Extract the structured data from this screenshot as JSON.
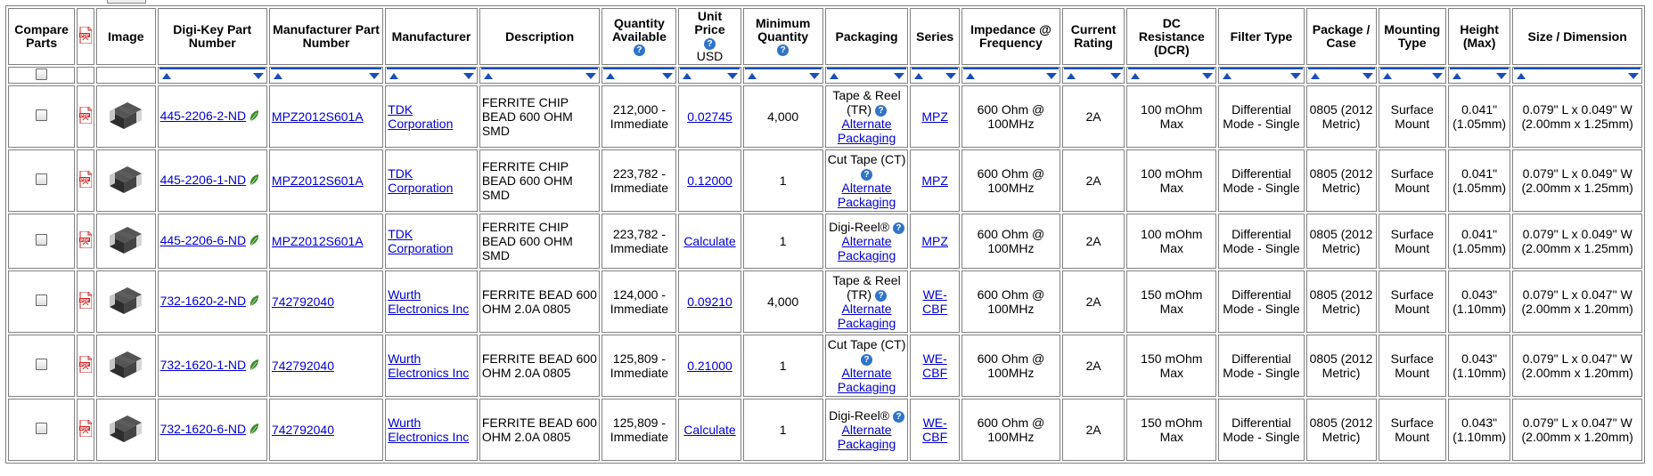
{
  "headers": {
    "compare": "Compare Parts",
    "image": "Image",
    "dk_part": "Digi-Key Part Number",
    "mfr_part": "Manufacturer Part Number",
    "manufacturer": "Manufacturer",
    "description": "Description",
    "qty_available": "Quantity Available",
    "unit_price": "Unit Price",
    "unit_price_currency": "USD",
    "min_qty": "Minimum Quantity",
    "packaging": "Packaging",
    "series": "Series",
    "impedance": "Impedance @ Frequency",
    "current": "Current Rating",
    "dcr": "DC Resistance (DCR)",
    "filter_type": "Filter Type",
    "package_case": "Package / Case",
    "mounting": "Mounting Type",
    "height": "Height (Max)",
    "size": "Size / Dimension"
  },
  "icons": {
    "help": "help-icon",
    "pdf": "pdf-datasheet-icon",
    "leaf": "rohs-leaf-icon",
    "sort_up": "sort-ascending-icon",
    "sort_down": "sort-descending-icon"
  },
  "colors": {
    "link": "#0000cc",
    "sort_accent": "#1b4fb7",
    "help_badge": "#2f74c8",
    "pdf_red": "#d42020",
    "leaf_green": "#3a8a2a"
  },
  "rows": [
    {
      "dk_part": "445-2206-2-ND",
      "mfr_part": "MPZ2012S601A",
      "manufacturer": "TDK Corporation",
      "description": "FERRITE CHIP BEAD 600 OHM SMD",
      "qty": "212,000 - Immediate",
      "price": "0.02745",
      "min_qty": "4,000",
      "packaging": "Tape & Reel (TR)",
      "alt_pack": "Alternate Packaging",
      "series": "MPZ",
      "impedance": "600 Ohm @ 100MHz",
      "current": "2A",
      "dcr": "100 mOhm Max",
      "filter_type": "Differential Mode - Single",
      "package_case": "0805 (2012 Metric)",
      "mounting": "Surface Mount",
      "height": "0.041\" (1.05mm)",
      "size": "0.079\" L x 0.049\" W (2.00mm x 1.25mm)"
    },
    {
      "dk_part": "445-2206-1-ND",
      "mfr_part": "MPZ2012S601A",
      "manufacturer": "TDK Corporation",
      "description": "FERRITE CHIP BEAD 600 OHM SMD",
      "qty": "223,782 - Immediate",
      "price": "0.12000",
      "min_qty": "1",
      "packaging": "Cut Tape (CT)",
      "alt_pack": "Alternate Packaging",
      "series": "MPZ",
      "impedance": "600 Ohm @ 100MHz",
      "current": "2A",
      "dcr": "100 mOhm Max",
      "filter_type": "Differential Mode - Single",
      "package_case": "0805 (2012 Metric)",
      "mounting": "Surface Mount",
      "height": "0.041\" (1.05mm)",
      "size": "0.079\" L x 0.049\" W (2.00mm x 1.25mm)"
    },
    {
      "dk_part": "445-2206-6-ND",
      "mfr_part": "MPZ2012S601A",
      "manufacturer": "TDK Corporation",
      "description": "FERRITE CHIP BEAD 600 OHM SMD",
      "qty": "223,782 - Immediate",
      "price": "Calculate",
      "min_qty": "1",
      "packaging": "Digi-Reel®",
      "alt_pack": "Alternate Packaging",
      "series": "MPZ",
      "impedance": "600 Ohm @ 100MHz",
      "current": "2A",
      "dcr": "100 mOhm Max",
      "filter_type": "Differential Mode - Single",
      "package_case": "0805 (2012 Metric)",
      "mounting": "Surface Mount",
      "height": "0.041\" (1.05mm)",
      "size": "0.079\" L x 0.049\" W (2.00mm x 1.25mm)"
    },
    {
      "dk_part": "732-1620-2-ND",
      "mfr_part": "742792040",
      "manufacturer": "Wurth Electronics Inc",
      "description": "FERRITE BEAD 600 OHM 2.0A 0805",
      "qty": "124,000 - Immediate",
      "price": "0.09210",
      "min_qty": "4,000",
      "packaging": "Tape & Reel (TR)",
      "alt_pack": "Alternate Packaging",
      "series": "WE-CBF",
      "impedance": "600 Ohm @ 100MHz",
      "current": "2A",
      "dcr": "150 mOhm Max",
      "filter_type": "Differential Mode - Single",
      "package_case": "0805 (2012 Metric)",
      "mounting": "Surface Mount",
      "height": "0.043\" (1.10mm)",
      "size": "0.079\" L x 0.047\" W (2.00mm x 1.20mm)"
    },
    {
      "dk_part": "732-1620-1-ND",
      "mfr_part": "742792040",
      "manufacturer": "Wurth Electronics Inc",
      "description": "FERRITE BEAD 600 OHM 2.0A 0805",
      "qty": "125,809 - Immediate",
      "price": "0.21000",
      "min_qty": "1",
      "packaging": "Cut Tape (CT)",
      "alt_pack": "Alternate Packaging",
      "series": "WE-CBF",
      "impedance": "600 Ohm @ 100MHz",
      "current": "2A",
      "dcr": "150 mOhm Max",
      "filter_type": "Differential Mode - Single",
      "package_case": "0805 (2012 Metric)",
      "mounting": "Surface Mount",
      "height": "0.043\" (1.10mm)",
      "size": "0.079\" L x 0.047\" W (2.00mm x 1.20mm)"
    },
    {
      "dk_part": "732-1620-6-ND",
      "mfr_part": "742792040",
      "manufacturer": "Wurth Electronics Inc",
      "description": "FERRITE BEAD 600 OHM 2.0A 0805",
      "qty": "125,809 - Immediate",
      "price": "Calculate",
      "min_qty": "1",
      "packaging": "Digi-Reel®",
      "alt_pack": "Alternate Packaging",
      "series": "WE-CBF",
      "impedance": "600 Ohm @ 100MHz",
      "current": "2A",
      "dcr": "150 mOhm Max",
      "filter_type": "Differential Mode - Single",
      "package_case": "0805 (2012 Metric)",
      "mounting": "Surface Mount",
      "height": "0.043\" (1.10mm)",
      "size": "0.079\" L x 0.047\" W (2.00mm x 1.20mm)"
    }
  ]
}
